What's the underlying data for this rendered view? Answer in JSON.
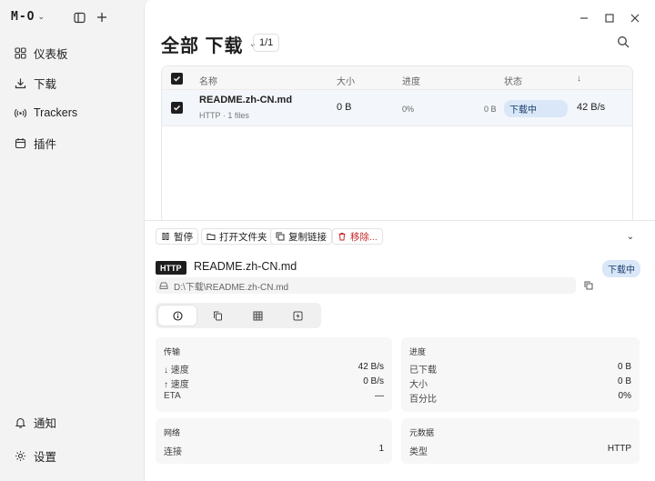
{
  "app": {
    "logo": "M-O"
  },
  "sidebar": {
    "items": [
      {
        "label": "仪表板",
        "icon": "dashboard-icon"
      },
      {
        "label": "下载",
        "icon": "download-icon"
      },
      {
        "label": "Trackers",
        "icon": "broadcast-icon"
      },
      {
        "label": "插件",
        "icon": "calendar-icon"
      }
    ],
    "bottom_items": [
      {
        "label": "通知",
        "icon": "bell-icon"
      },
      {
        "label": "设置",
        "icon": "gear-icon"
      }
    ]
  },
  "header": {
    "title": "全部 下载",
    "pager": "1/1"
  },
  "table": {
    "columns": {
      "name": "名称",
      "size": "大小",
      "progress": "进度",
      "status": "状态",
      "speed_arrow": "↓"
    },
    "rows": [
      {
        "name": "README.zh-CN.md",
        "sub": "HTTP · 1 files",
        "size": "0 B",
        "progress_pct": "0%",
        "progress_bytes": "0 B",
        "progress_value": 0,
        "status": "下载中",
        "speed": "42 B/s",
        "checked": true
      }
    ]
  },
  "detail": {
    "toolbar": {
      "pause": "暂停",
      "open_folder": "打开文件夹",
      "copy_link": "复制链接",
      "remove": "移除..."
    },
    "protocol": "HTTP",
    "filename": "README.zh-CN.md",
    "status": "下载中",
    "path": "D:\\下载\\README.zh-CN.md",
    "tabs": [
      {
        "icon": "info-icon"
      },
      {
        "icon": "files-icon"
      },
      {
        "icon": "grid-icon"
      },
      {
        "icon": "lightning-icon"
      }
    ],
    "transfer": {
      "title": "传输",
      "down_label": "↓ 速度",
      "down_value": "42 B/s",
      "up_label": "↑ 速度",
      "up_value": "0 B/s",
      "eta_label": "ETA",
      "eta_value": "—"
    },
    "progress": {
      "title": "进度",
      "downloaded_label": "已下载",
      "downloaded_value": "0 B",
      "size_label": "大小",
      "size_value": "0 B",
      "percent_label": "百分比",
      "percent_value": "0%"
    },
    "network": {
      "title": "网络",
      "conn_label": "连接",
      "conn_value": "1"
    },
    "metadata": {
      "title": "元数据",
      "type_label": "类型",
      "type_value": "HTTP"
    }
  },
  "colors": {
    "accent": "#1e1e1e",
    "status_badge_bg": "#d9e7f8",
    "remove_red": "#c62828"
  }
}
